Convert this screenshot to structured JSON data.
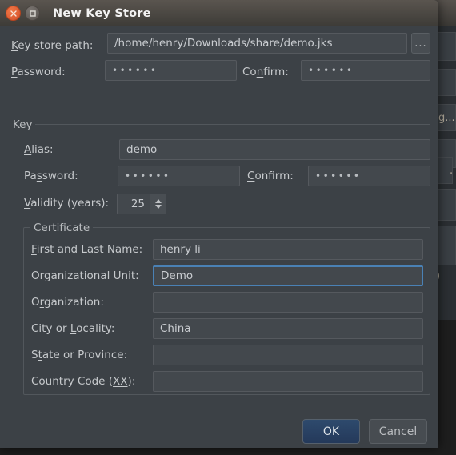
{
  "window": {
    "title": "New Key Store",
    "close_icon": "close-icon",
    "maximize_icon": "maximize-icon"
  },
  "keystore": {
    "path_label": "Key store path:",
    "path_label_mnemonic": "K",
    "path_value": "/home/henry/Downloads/share/demo.jks",
    "browse_label": "...",
    "password_label": "Password:",
    "password_label_mnemonic": "P",
    "password_value": "••••••",
    "confirm_label": "Confirm:",
    "confirm_label_mnemonic": "n",
    "confirm_value": "••••••"
  },
  "key_group": {
    "title": "Key",
    "alias_label": "Alias:",
    "alias_label_mnemonic": "A",
    "alias_value": "demo",
    "password_label": "Password:",
    "password_label_mnemonic": "s",
    "password_value": "••••••",
    "confirm_label": "Confirm:",
    "confirm_label_mnemonic": "C",
    "confirm_value": "••••••",
    "validity_label": "Validity (years):",
    "validity_label_mnemonic": "V",
    "validity_value": "25",
    "spinner_up_icon": "spinner-up-icon",
    "spinner_down_icon": "spinner-down-icon"
  },
  "certificate_group": {
    "title": "Certificate",
    "rows": [
      {
        "label": "First and Last Name:",
        "mnemonic": "F",
        "value": "henry li",
        "focused": false
      },
      {
        "label": "Organizational Unit:",
        "mnemonic": "O",
        "value": "Demo",
        "focused": true
      },
      {
        "label": "Organization:",
        "mnemonic": "r",
        "value": "",
        "focused": false
      },
      {
        "label": "City or Locality:",
        "mnemonic": "L",
        "value": "China",
        "focused": false
      },
      {
        "label": "State or Province:",
        "mnemonic": "t",
        "value": "",
        "focused": false
      },
      {
        "label": "Country Code (XX):",
        "mnemonic": "XX",
        "value": "",
        "focused": false
      }
    ]
  },
  "buttons": {
    "ok_label": "OK",
    "cancel_label": "Cancel"
  },
  "background": {
    "fragment_1": "g...",
    "fragment_2": "·",
    "fragment_3": ")"
  },
  "colors": {
    "dialog_bg": "#3c4146",
    "field_bg": "#43484d",
    "focus_border": "#4a81b5",
    "accent_ok": "#2e4a6d",
    "close_button": "#e2572c",
    "text": "#c6c9cc"
  }
}
